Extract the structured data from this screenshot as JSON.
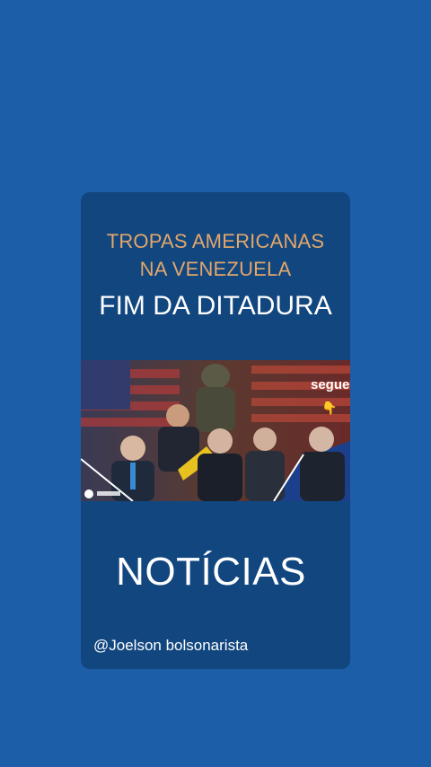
{
  "post": {
    "headline_line1": "TROPAS AMERICANAS",
    "headline_line2": "NA VENEZUELA",
    "headline_line3": "FIM DA DITADURA",
    "image_overlay": "segue",
    "section_label": "NOTÍCIAS",
    "author_handle": "@Joelson bolsonarista"
  },
  "colors": {
    "background": "#1d5ea8",
    "card": "#11467f",
    "accent_text": "#e3a66b"
  }
}
